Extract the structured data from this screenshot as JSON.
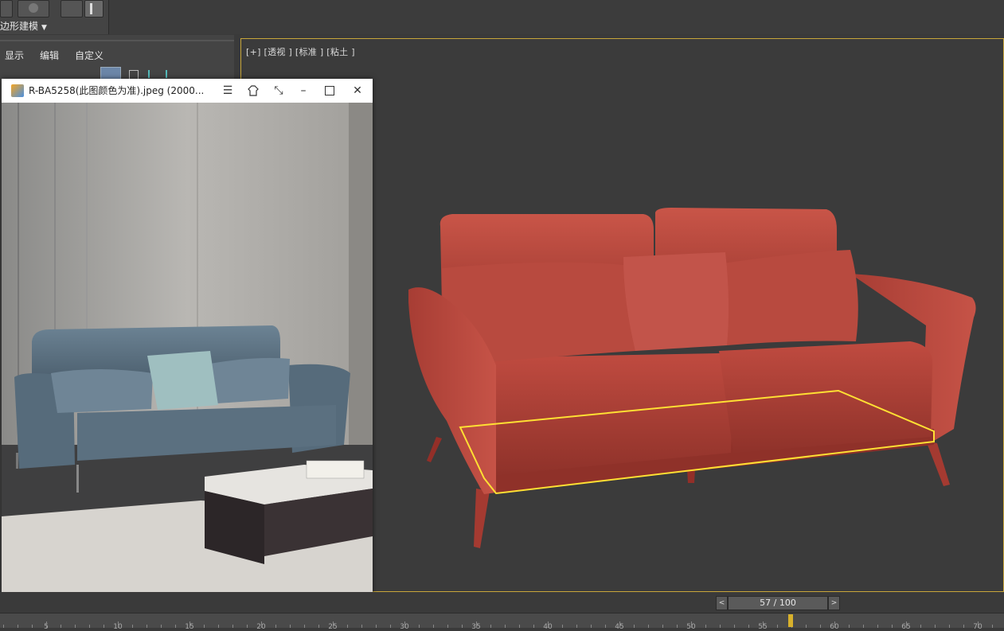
{
  "ribbon": {
    "label": "边形建模"
  },
  "left_menu": {
    "display": "显示",
    "edit": "编辑",
    "customize": "自定义"
  },
  "viewport": {
    "label": "[+]  [透视 ]  [标准 ]  [粘土 ]"
  },
  "viewer": {
    "title": "R-BA5258(此图颜色为准).jpeg  (2000..."
  },
  "timeline": {
    "frame": "57 / 100",
    "prev": "<",
    "next": ">",
    "tick_labels": [
      "5",
      "10",
      "15",
      "20",
      "25",
      "30",
      "35",
      "40",
      "45",
      "50",
      "55",
      "60",
      "65",
      "70"
    ]
  },
  "colors": {
    "sofa_red": "#b8463b",
    "selection_yellow": "#ffe033",
    "photo_sofa_blue": "#5d7384",
    "time_marker": "#d8b12c"
  },
  "icons": {
    "viewer_app": "image-viewer-icon",
    "menu": "hamburger-icon",
    "pin": "shirt-pin-icon",
    "fullscreen": "expand-icon",
    "minimize": "minimize-icon",
    "maximize": "maximize-icon",
    "close": "close-icon"
  }
}
